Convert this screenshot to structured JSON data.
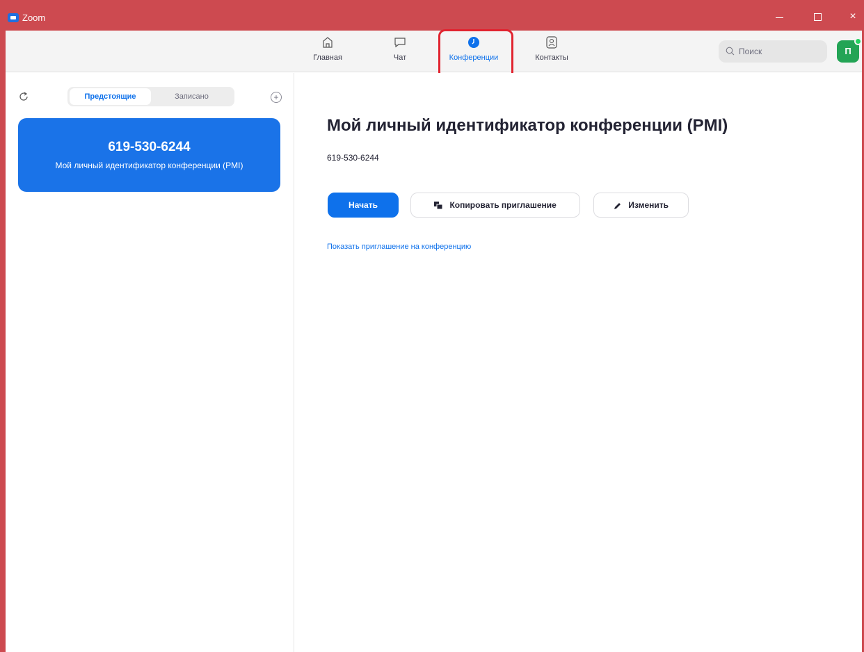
{
  "window": {
    "title": "Zoom",
    "controls": {
      "close": "×"
    }
  },
  "nav": {
    "tabs": [
      {
        "label": "Главная",
        "icon": "home-icon"
      },
      {
        "label": "Чат",
        "icon": "chat-icon"
      },
      {
        "label": "Конференции",
        "icon": "clock-icon",
        "active": true
      },
      {
        "label": "Контакты",
        "icon": "contacts-icon"
      }
    ],
    "search_placeholder": "Поиск",
    "avatar_initials": "П"
  },
  "sidebar": {
    "segments": [
      {
        "label": "Предстоящие",
        "active": true
      },
      {
        "label": "Записано",
        "active": false
      }
    ],
    "add_symbol": "+",
    "card": {
      "id": "619-530-6244",
      "subtitle": "Мой личный идентификатор конференции (PMI)"
    }
  },
  "main": {
    "title": "Мой личный идентификатор конференции (PMI)",
    "meeting_id": "619-530-6244",
    "buttons": {
      "start": "Начать",
      "copy": "Копировать приглашение",
      "edit": "Изменить"
    },
    "show_invite_link": "Показать приглашение на конференцию"
  },
  "colors": {
    "titlebar": "#cd4a50",
    "accent": "#0e71eb",
    "card": "#1a73e8",
    "highlight": "#e12430",
    "avatar": "#23a455"
  }
}
